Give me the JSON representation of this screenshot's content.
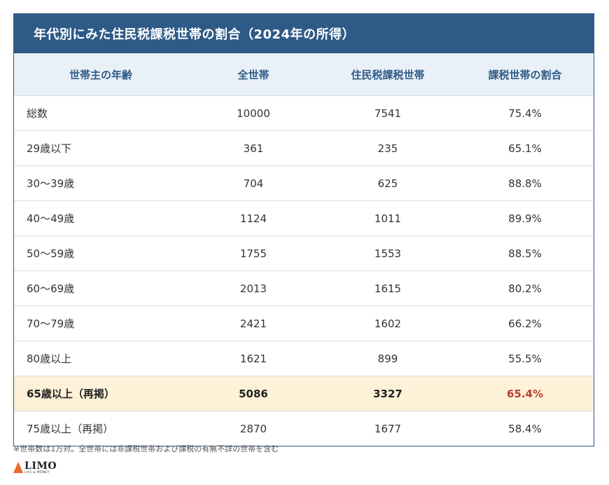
{
  "chart_data": {
    "type": "table",
    "title": "年代別にみた住民税課税世帯の割合（2024年の所得）",
    "columns": [
      "世帯主の年齢",
      "全世帯",
      "住民税課税世帯",
      "課税世帯の割合"
    ],
    "rows": [
      {
        "label": "総数",
        "all": "10000",
        "taxed": "7541",
        "ratio": "75.4%"
      },
      {
        "label": "29歳以下",
        "all": "361",
        "taxed": "235",
        "ratio": "65.1%"
      },
      {
        "label": "30～39歳",
        "all": "704",
        "taxed": "625",
        "ratio": "88.8%"
      },
      {
        "label": "40～49歳",
        "all": "1124",
        "taxed": "1011",
        "ratio": "89.9%"
      },
      {
        "label": "50～59歳",
        "all": "1755",
        "taxed": "1553",
        "ratio": "88.5%"
      },
      {
        "label": "60～69歳",
        "all": "2013",
        "taxed": "1615",
        "ratio": "80.2%"
      },
      {
        "label": "70～79歳",
        "all": "2421",
        "taxed": "1602",
        "ratio": "66.2%"
      },
      {
        "label": "80歳以上",
        "all": "1621",
        "taxed": "899",
        "ratio": "55.5%"
      },
      {
        "label": "65歳以上（再掲）",
        "all": "5086",
        "taxed": "3327",
        "ratio": "65.4%",
        "highlight": true
      },
      {
        "label": "75歳以上（再掲）",
        "all": "2870",
        "taxed": "1677",
        "ratio": "58.4%"
      }
    ]
  },
  "footnote": "※世帯数は1万対。全世帯には非課税世帯および課税の有無不詳の世帯を含む",
  "logo": {
    "main": "LIMO",
    "sub": "LIFE & MONEY"
  },
  "colors": {
    "header_bg": "#2e5a87",
    "column_header_bg": "#e9f0f7",
    "highlight_bg": "#fdf1d8",
    "highlight_ratio": "#b8402e",
    "logo_accent": "#e86a2c"
  }
}
